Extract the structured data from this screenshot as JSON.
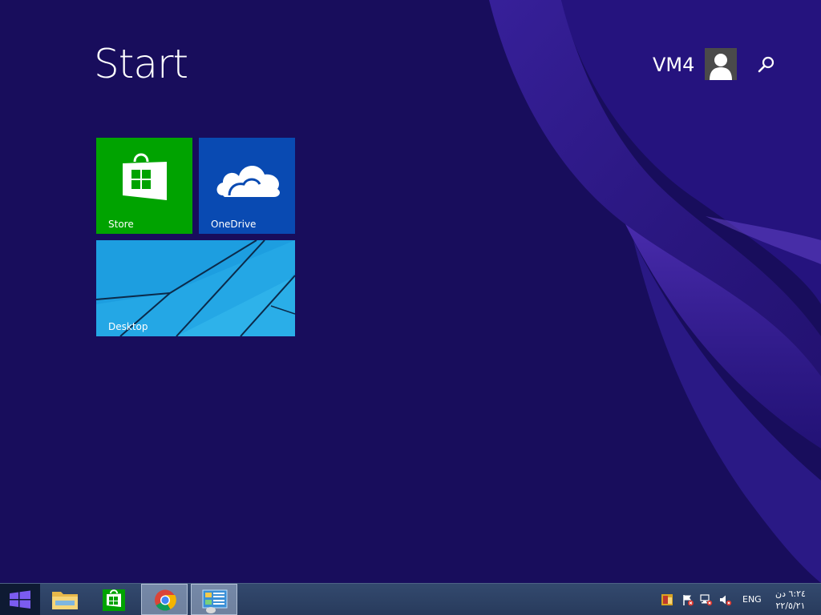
{
  "start_screen": {
    "title": "Start",
    "user": {
      "name": "VM4"
    }
  },
  "tiles": [
    {
      "label": "Store",
      "icon": "store-bag-icon",
      "color": "#00a300"
    },
    {
      "label": "OneDrive",
      "icon": "cloud-icon",
      "color": "#094ab2"
    },
    {
      "label": "Desktop",
      "icon": "desktop-wallpaper",
      "color": "#1d9ee0"
    }
  ],
  "taskbar": {
    "apps": [
      {
        "name": "File Explorer",
        "icon": "folder-icon"
      },
      {
        "name": "Store",
        "icon": "store-icon"
      },
      {
        "name": "Google Chrome",
        "icon": "chrome-icon"
      },
      {
        "name": "Control Panel",
        "icon": "control-panel-icon"
      }
    ],
    "tray": {
      "language": "ENG",
      "time": "٦:٢٤ دن",
      "date": "٢٢/٥/٢١"
    }
  },
  "colors": {
    "background": "#180d5c",
    "store_tile": "#00a300",
    "onedrive_tile": "#094ab2",
    "desktop_tile": "#1d9ee0"
  }
}
